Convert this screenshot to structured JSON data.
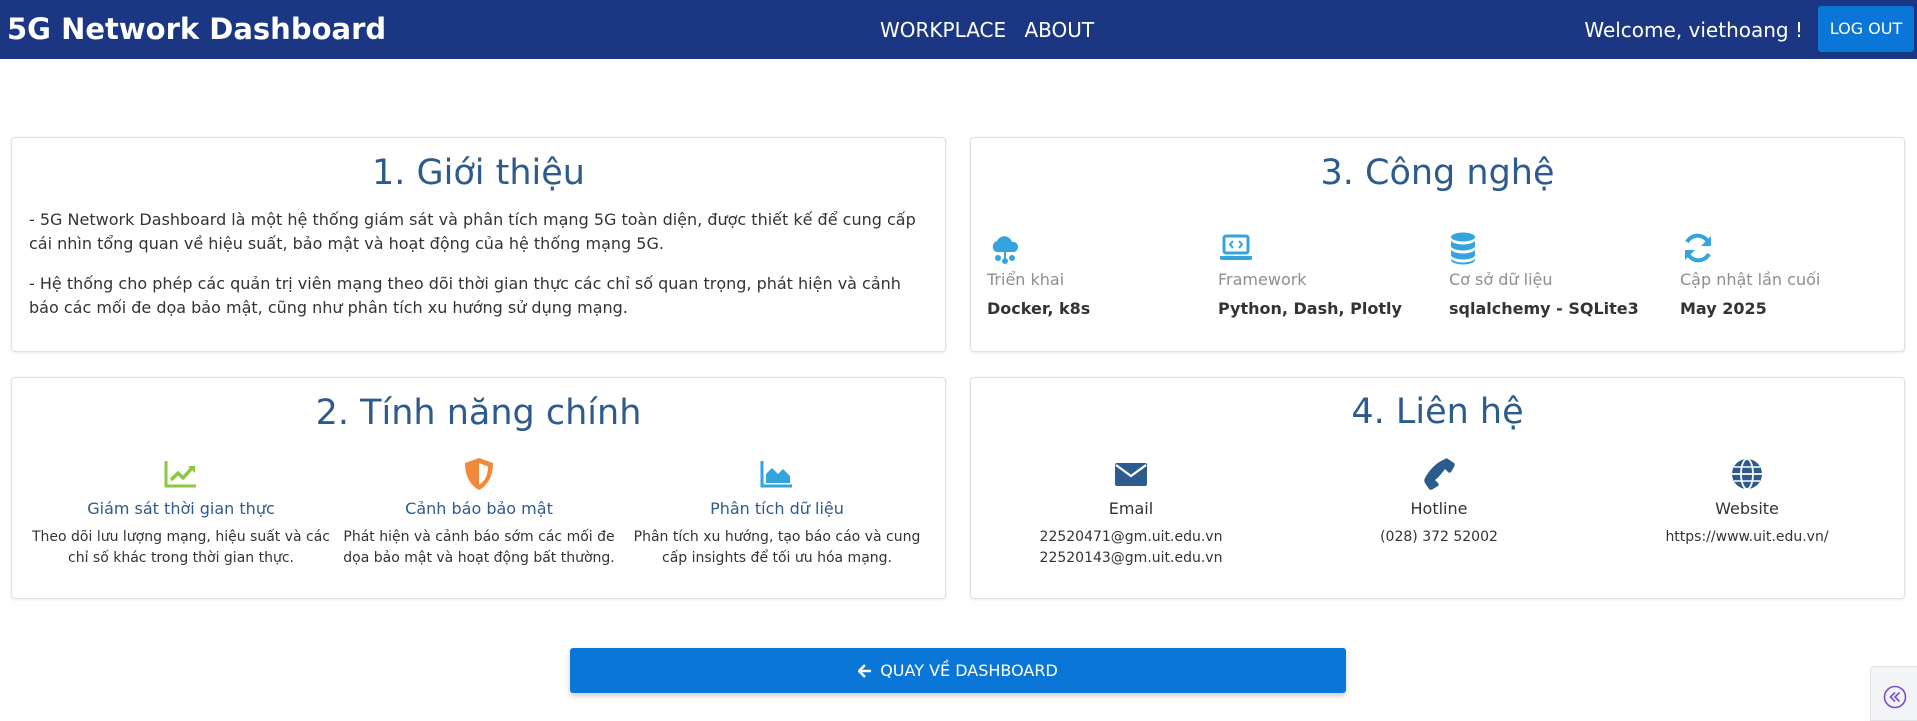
{
  "header": {
    "brand": "5G Network Dashboard",
    "nav": [
      "WORKPLACE",
      "ABOUT"
    ],
    "welcome": "Welcome, viethoang !",
    "logout_label": "LOG OUT",
    "background_color": "#1b3783"
  },
  "intro": {
    "title": "1. Giới thiệu",
    "paragraphs": [
      "- 5G Network Dashboard là một hệ thống giám sát và phân tích mạng 5G toàn diện, được thiết kế để cung cấp cái nhìn tổng quan về hiệu suất, bảo mật và hoạt động của hệ thống mạng 5G.",
      "- Hệ thống cho phép các quản trị viên mạng theo dõi thời gian thực các chỉ số quan trọng, phát hiện và cảnh báo các mối đe dọa bảo mật, cũng như phân tích xu hướng sử dụng mạng."
    ]
  },
  "features": {
    "title": "2. Tính năng chính",
    "items": [
      {
        "icon": "chart-line-icon",
        "color": "#8dc63f",
        "title": "Giám sát thời gian thực",
        "desc": "Theo dõi lưu lượng mạng, hiệu suất và các chỉ số khác trong thời gian thực."
      },
      {
        "icon": "shield-icon",
        "color": "#f08a3a",
        "title": "Cảnh báo bảo mật",
        "desc": "Phát hiện và cảnh báo sớm các mối đe dọa bảo mật và hoạt động bất thường."
      },
      {
        "icon": "chart-area-icon",
        "color": "#33a4dd",
        "title": "Phân tích dữ liệu",
        "desc": "Phân tích xu hướng, tạo báo cáo và cung cấp insights để tối ưu hóa mạng."
      }
    ]
  },
  "tech": {
    "title": "3. Công nghệ",
    "items": [
      {
        "icon": "cloud-network-icon",
        "label": "Triển khai",
        "value": "Docker, k8s"
      },
      {
        "icon": "laptop-code-icon",
        "label": "Framework",
        "value": "Python, Dash, Plotly"
      },
      {
        "icon": "database-icon",
        "label": "Cơ sở dữ liệu",
        "value": "sqlalchemy - SQLite3"
      },
      {
        "icon": "sync-icon",
        "label": "Cập nhật lần cuối",
        "value": "May 2025"
      }
    ],
    "icon_color": "#33a4dd"
  },
  "contact": {
    "title": "4. Liên hệ",
    "items": [
      {
        "icon": "envelope-icon",
        "title": "Email",
        "lines": [
          "22520471@gm.uit.edu.vn",
          "22520143@gm.uit.edu.vn"
        ]
      },
      {
        "icon": "phone-icon",
        "title": "Hotline",
        "lines": [
          "(028) 372 52002"
        ]
      },
      {
        "icon": "globe-icon",
        "title": "Website",
        "lines": [
          "https://www.uit.edu.vn/"
        ]
      }
    ],
    "icon_color": "#2d5b8d"
  },
  "back_button": {
    "label": "QUAY VỀ DASHBOARD",
    "icon": "arrow-left-icon"
  },
  "side_widget": {
    "icon": "double-chevron-left-icon"
  }
}
